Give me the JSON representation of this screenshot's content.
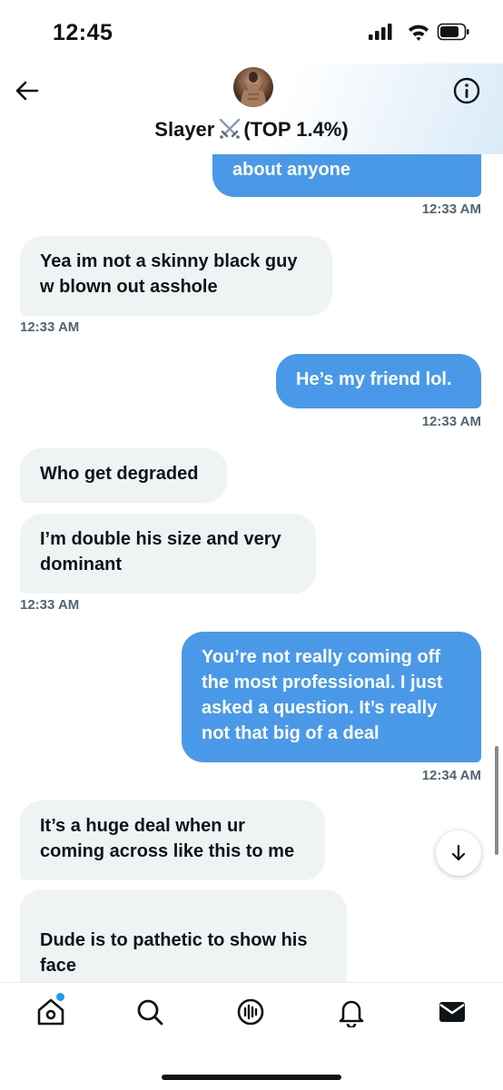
{
  "status_bar": {
    "time": "12:45"
  },
  "header": {
    "contact_name": "Slayer",
    "contact_badge": "(TOP 1.4%)"
  },
  "messages": [
    {
      "from": "me",
      "text": "about anyone"
    },
    {
      "timestamp": "12:33 AM"
    },
    {
      "from": "them",
      "text": "Yea im not a skinny black guy w blown out asshole"
    },
    {
      "timestamp": "12:33 AM"
    },
    {
      "from": "me",
      "text": "He’s my friend lol."
    },
    {
      "timestamp": "12:33 AM"
    },
    {
      "from": "them",
      "text": "Who get degraded"
    },
    {
      "from": "them",
      "text": "I’m double his size and very dominant"
    },
    {
      "timestamp": "12:33 AM"
    },
    {
      "from": "me",
      "text": "You’re not really coming off the most professional. I just asked a question. It’s really not that big of a deal"
    },
    {
      "timestamp": "12:34 AM"
    },
    {
      "from": "them",
      "text": "It’s a huge deal when ur coming across like this to me"
    },
    {
      "from": "them",
      "text": "Dude is to pathetic to show his face\nI have TS tatted on my neck I"
    }
  ],
  "icons": {
    "back": "arrow-left-icon",
    "info": "info-icon",
    "swords": "crossed-swords-icon",
    "scroll": "arrow-down-icon",
    "home": "home-icon",
    "search": "search-icon",
    "spaces": "spaces-icon",
    "notifications": "bell-icon",
    "messages": "envelope-icon"
  },
  "colors": {
    "sent_bubble": "#4a99e9",
    "received_bubble": "#eff3f4",
    "accent": "#1d9bf0"
  }
}
